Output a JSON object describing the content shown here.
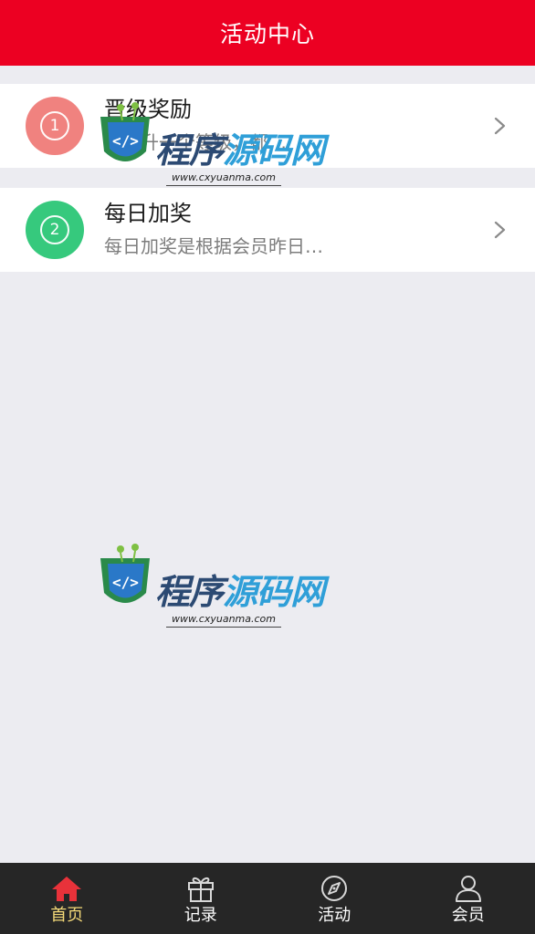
{
  "header": {
    "title": "活动中心"
  },
  "activities": [
    {
      "number": "1",
      "title": "晋级奖励",
      "description": "每晋升一个等级，都…",
      "badge_color": "#f0827f",
      "chevron": "chevron-right-icon"
    },
    {
      "number": "2",
      "title": "每日加奖",
      "description": "每日加奖是根据会员昨日…",
      "badge_color": "#36c97d",
      "chevron": "chevron-right-icon"
    }
  ],
  "tabbar": {
    "items": [
      {
        "label": "首页",
        "icon": "home-icon",
        "active": true
      },
      {
        "label": "记录",
        "icon": "gift-icon",
        "active": false
      },
      {
        "label": "活动",
        "icon": "compass-icon",
        "active": false
      },
      {
        "label": "会员",
        "icon": "user-icon",
        "active": false
      }
    ]
  },
  "watermark": {
    "text_part1": "程序",
    "text_part2": "源码网",
    "url": "www.cxyuanma.com"
  },
  "colors": {
    "header_bg": "#ec0022",
    "page_bg": "#ececf1",
    "tabbar_bg": "#262626",
    "tab_active": "#f4d978",
    "home_icon": "#e8323a"
  }
}
